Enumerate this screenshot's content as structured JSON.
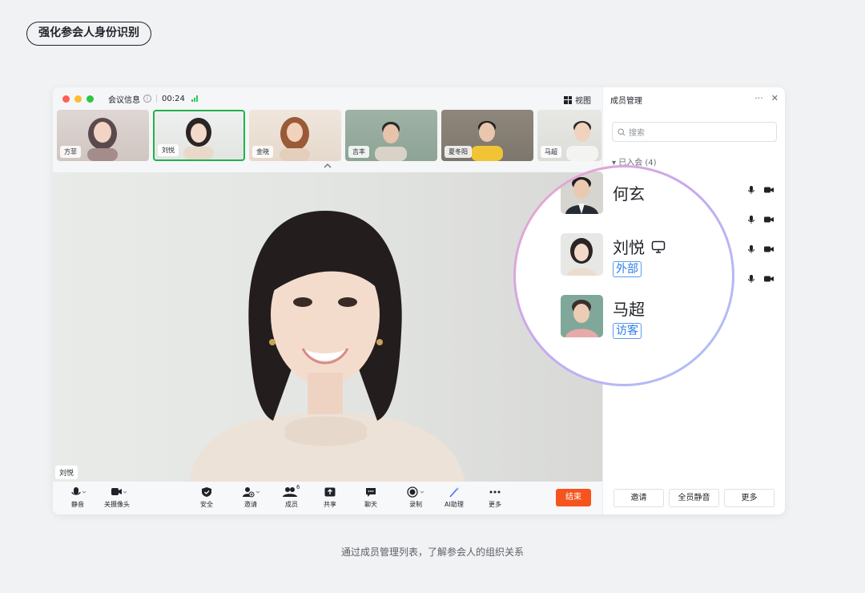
{
  "page_badge": "强化参会人身份识别",
  "caption": "通过成员管理列表，了解参会人的组织关系",
  "window": {
    "title": "会议信息",
    "timer": "00:24",
    "view_label": "视图",
    "thumbnails": [
      {
        "name": "方菲",
        "active": false
      },
      {
        "name": "刘悦",
        "active": true
      },
      {
        "name": "金晓",
        "active": false
      },
      {
        "name": "吉丰",
        "active": false
      },
      {
        "name": "夏冬阳",
        "active": false
      },
      {
        "name": "马超",
        "active": false
      }
    ],
    "speaker_label": "刘悦",
    "toolbar": {
      "mute": "静音",
      "camera_off": "关摄像头",
      "security": "安全",
      "invite": "邀请",
      "members": "成员",
      "members_count": "6",
      "share": "共享",
      "chat": "聊天",
      "record": "录制",
      "ai_assistant": "AI助理",
      "more": "更多",
      "end": "结束"
    }
  },
  "panel": {
    "title": "成员管理",
    "more_icon": "···",
    "close_icon": "✕",
    "search_placeholder": "搜索",
    "joined_label": "已入会 (4)",
    "buttons": {
      "invite": "邀请",
      "mute_all": "全员静音",
      "more": "更多"
    }
  },
  "magnifier": {
    "members": [
      {
        "name": "何玄",
        "tag": ""
      },
      {
        "name": "刘悦",
        "tag": "外部",
        "screen_icon": "monitor-icon"
      },
      {
        "name": "马超",
        "tag": "访客"
      }
    ]
  },
  "colors": {
    "accent_green": "#22b14c",
    "end_button": "#f5541d",
    "tag_blue": "#2b7de9"
  }
}
